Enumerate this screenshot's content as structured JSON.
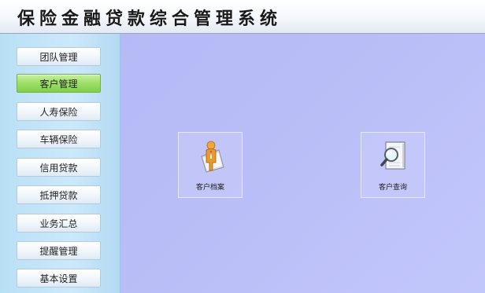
{
  "app": {
    "title": "保险金融贷款综合管理系统"
  },
  "sidebar": {
    "items": [
      {
        "label": "团队管理",
        "active": false
      },
      {
        "label": "客户管理",
        "active": true
      },
      {
        "label": "人寿保险",
        "active": false
      },
      {
        "label": "车辆保险",
        "active": false
      },
      {
        "label": "信用贷款",
        "active": false
      },
      {
        "label": "抵押贷款",
        "active": false
      },
      {
        "label": "业务汇总",
        "active": false
      },
      {
        "label": "提醒管理",
        "active": false
      },
      {
        "label": "基本设置",
        "active": false
      }
    ]
  },
  "main": {
    "tiles": [
      {
        "label": "客户档案",
        "icon": "customer-profile-icon"
      },
      {
        "label": "客户查询",
        "icon": "customer-search-icon"
      }
    ]
  },
  "colors": {
    "active_nav": "#9edf67",
    "main_background": "#b9bdf7",
    "sidebar_background": "#cbe9fb"
  }
}
